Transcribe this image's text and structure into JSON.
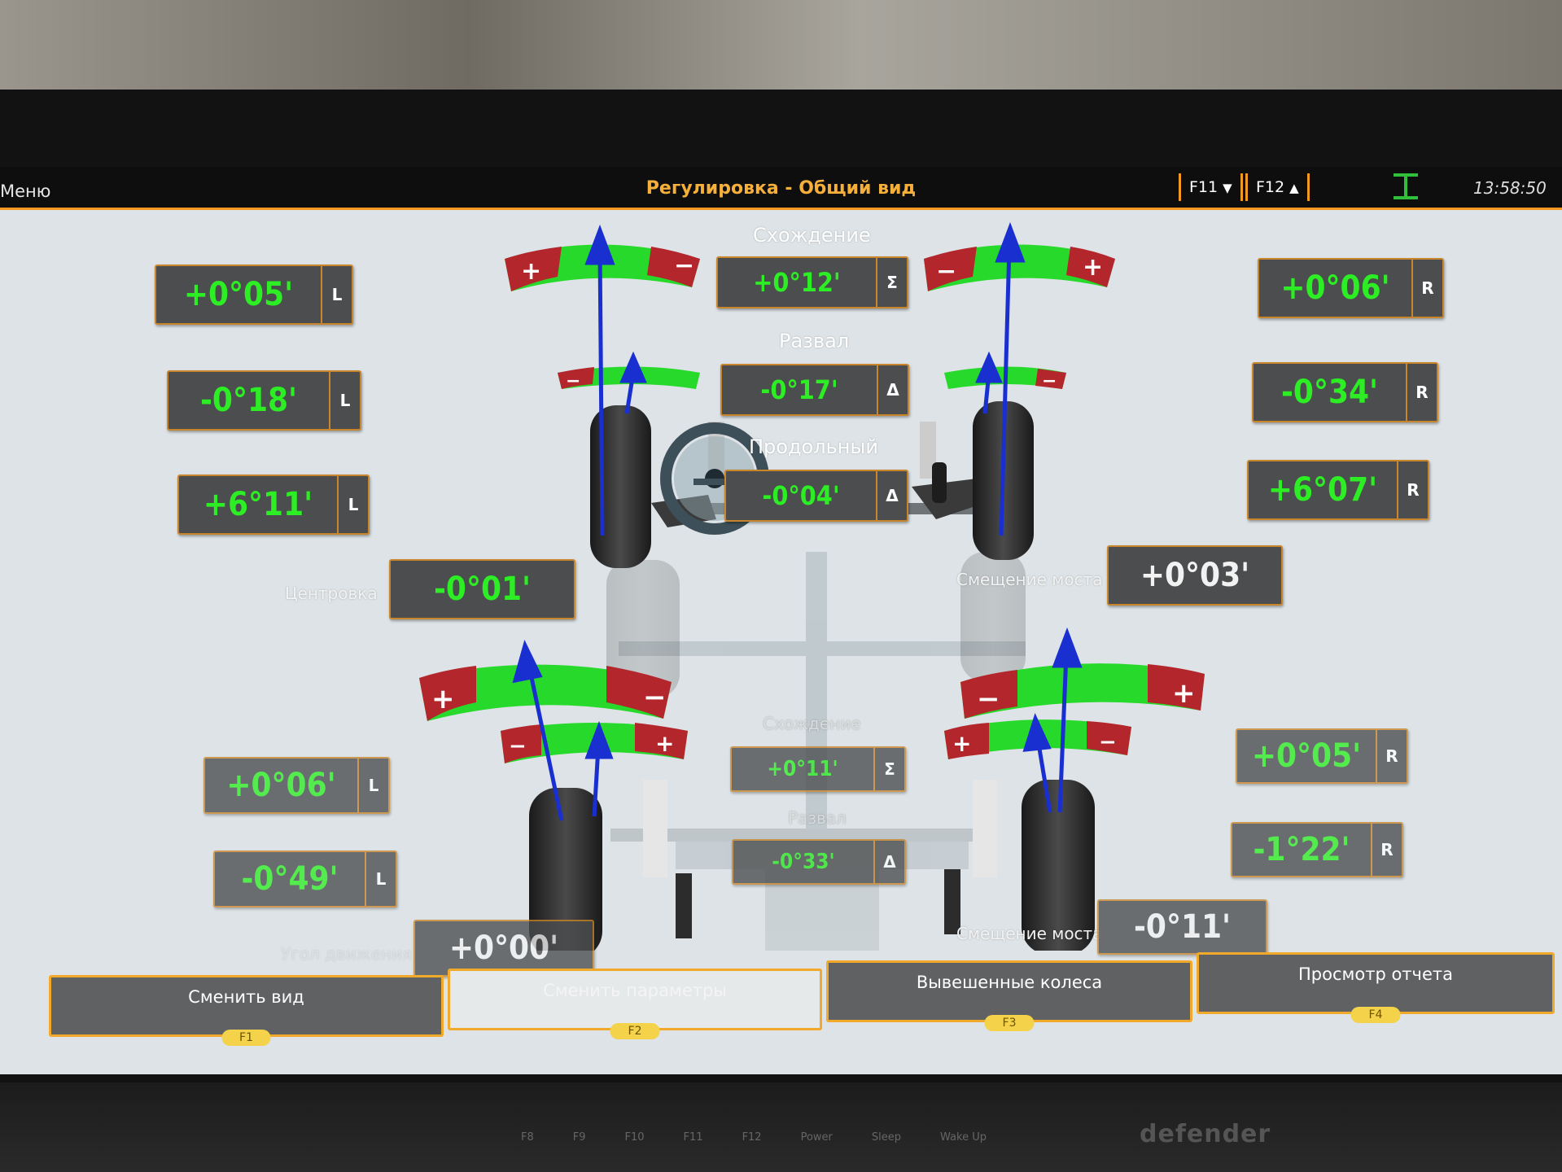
{
  "topbar": {
    "menu": "Меню",
    "title": "Регулировка - Общий вид",
    "f11": "F11",
    "f12": "F12",
    "time": "13:58:50"
  },
  "front": {
    "left": {
      "toe": "+0°05'",
      "camber": "-0°18'",
      "caster": "+6°11'",
      "side": "L"
    },
    "right": {
      "toe": "+0°06'",
      "camber": "-0°34'",
      "caster": "+6°07'",
      "side": "R"
    },
    "center": {
      "toe_label": "Схождение",
      "toe_total": "+0°12'",
      "toe_symbol": "Σ",
      "camber_label": "Развал",
      "camber_diff": "-0°17'",
      "camber_symbol": "Δ",
      "caster_label": "Продольный",
      "caster_diff": "-0°04'",
      "caster_symbol": "Δ"
    },
    "centering_label": "Центровка",
    "centering_value": "-0°01'",
    "setback_label": "Смещение моста",
    "setback_value": "+0°03'"
  },
  "rear": {
    "left": {
      "toe": "+0°06'",
      "camber": "-0°49'",
      "side": "L"
    },
    "right": {
      "toe": "+0°05'",
      "camber": "-1°22'",
      "side": "R"
    },
    "center": {
      "toe_label": "Схождение",
      "toe_total": "+0°11'",
      "toe_symbol": "Σ",
      "camber_label": "Развал",
      "camber_diff": "-0°33'",
      "camber_symbol": "Δ"
    },
    "thrust_label": "Угол движения",
    "thrust_value": "+0°00'",
    "setback_label": "Смещение моста",
    "setback_value": "-0°11'"
  },
  "softkeys": [
    {
      "label": "Сменить вид",
      "key": "F1"
    },
    {
      "label": "Сменить параметры",
      "key": "F2"
    },
    {
      "label": "Вывешенные колеса",
      "key": "F3"
    },
    {
      "label": "Просмотр отчета",
      "key": "F4"
    }
  ],
  "monitor": {
    "keyboard_brand": "defender",
    "keys": [
      "F8",
      "F9",
      "F10",
      "F11",
      "F12",
      "Power",
      "Sleep",
      "Wake Up"
    ]
  },
  "colors": {
    "value_green": "#2dee24",
    "accent_orange": "#f39a1e",
    "scale_green": "#27d92b",
    "scale_red": "#b3262b",
    "arrow_blue": "#1a2fd0"
  }
}
